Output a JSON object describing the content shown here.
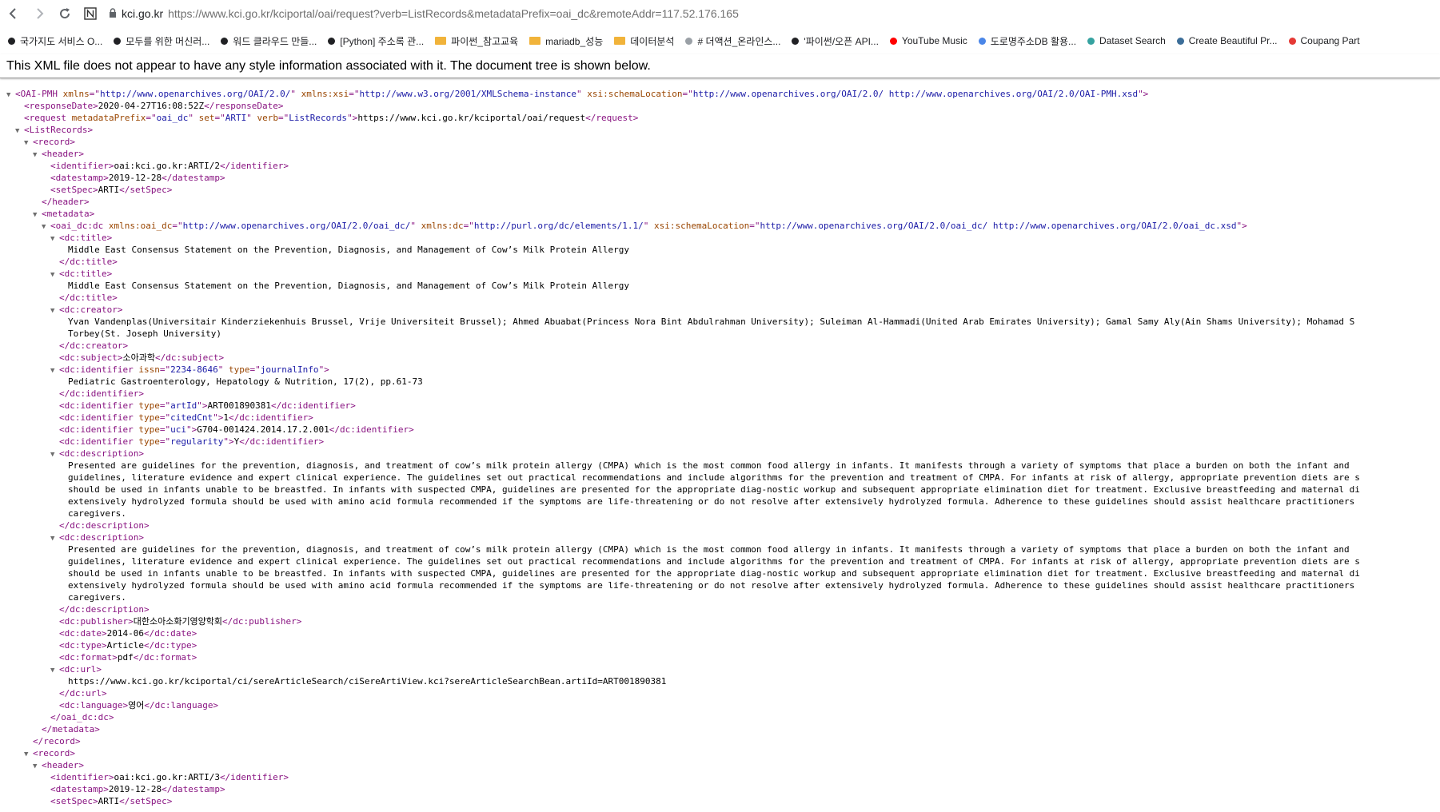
{
  "browser": {
    "domain": "kci.go.kr",
    "url_rest": "https://www.kci.go.kr/kciportal/oai/request?verb=ListRecords&metadataPrefix=oai_dc&remoteAddr=117.52.176.165",
    "icons": [
      "back-arrow-icon",
      "forward-arrow-icon",
      "reload-icon",
      "n-extension-icon",
      "lock-icon"
    ]
  },
  "bookmarks": [
    {
      "label": "국가지도 서비스 O...",
      "icon": "dot",
      "color": "#202124"
    },
    {
      "label": "모두를 위한 머신러...",
      "icon": "dot",
      "color": "#202124"
    },
    {
      "label": "워드 클라우드 만들...",
      "icon": "dot",
      "color": "#202124"
    },
    {
      "label": "[Python] 주소록 관...",
      "icon": "dot",
      "color": "#202124"
    },
    {
      "label": "파이썬_참고교육",
      "icon": "folder",
      "color": "#f1b33a"
    },
    {
      "label": "mariadb_성능",
      "icon": "folder",
      "color": "#f1b33a"
    },
    {
      "label": "데이터분석",
      "icon": "folder",
      "color": "#f1b33a"
    },
    {
      "label": "# 더액션_온라인스...",
      "icon": "dot",
      "color": "#9aa0a6"
    },
    {
      "label": "'파이썬/오픈 API...",
      "icon": "dot",
      "color": "#202124"
    },
    {
      "label": "YouTube Music",
      "icon": "dot",
      "color": "#ff0000"
    },
    {
      "label": "도로명주소DB 활용...",
      "icon": "dot",
      "color": "#4a86e8"
    },
    {
      "label": "Dataset Search",
      "icon": "dot",
      "color": "#35a2a0"
    },
    {
      "label": "Create Beautiful Pr...",
      "icon": "dot",
      "color": "#3c6e99"
    },
    {
      "label": "Coupang Part",
      "icon": "dot",
      "color": "#e53935"
    }
  ],
  "info_text": "This XML file does not appear to have any style information associated with it. The document tree is shown below.",
  "tree": [
    {
      "ind": 0,
      "tog": "▼",
      "s": [
        [
          "t",
          "<OAI-PMH "
        ],
        [
          "an",
          "xmlns"
        ],
        [
          "t",
          "=\""
        ],
        [
          "av",
          "http://www.openarchives.org/OAI/2.0/"
        ],
        [
          "t",
          "\" "
        ],
        [
          "an",
          "xmlns:xsi"
        ],
        [
          "t",
          "=\""
        ],
        [
          "av",
          "http://www.w3.org/2001/XMLSchema-instance"
        ],
        [
          "t",
          "\" "
        ],
        [
          "an",
          "xsi:schemaLocation"
        ],
        [
          "t",
          "=\""
        ],
        [
          "av",
          "http://www.openarchives.org/OAI/2.0/ http://www.openarchives.org/OAI/2.0/OAI-PMH.xsd"
        ],
        [
          "t",
          "\">"
        ]
      ]
    },
    {
      "ind": 1,
      "tog": "",
      "s": [
        [
          "t",
          "<responseDate>"
        ],
        [
          "x",
          "2020-04-27T16:08:52Z"
        ],
        [
          "t",
          "</responseDate>"
        ]
      ]
    },
    {
      "ind": 1,
      "tog": "",
      "s": [
        [
          "t",
          "<request "
        ],
        [
          "an",
          "metadataPrefix"
        ],
        [
          "t",
          "=\""
        ],
        [
          "av",
          "oai_dc"
        ],
        [
          "t",
          "\" "
        ],
        [
          "an",
          "set"
        ],
        [
          "t",
          "=\""
        ],
        [
          "av",
          "ARTI"
        ],
        [
          "t",
          "\" "
        ],
        [
          "an",
          "verb"
        ],
        [
          "t",
          "=\""
        ],
        [
          "av",
          "ListRecords"
        ],
        [
          "t",
          "\">"
        ],
        [
          "x",
          "https://www.kci.go.kr/kciportal/oai/request"
        ],
        [
          "t",
          "</request>"
        ]
      ]
    },
    {
      "ind": 1,
      "tog": "▼",
      "s": [
        [
          "t",
          "<ListRecords>"
        ]
      ]
    },
    {
      "ind": 2,
      "tog": "▼",
      "s": [
        [
          "t",
          "<record>"
        ]
      ]
    },
    {
      "ind": 3,
      "tog": "▼",
      "s": [
        [
          "t",
          "<header>"
        ]
      ]
    },
    {
      "ind": 4,
      "tog": "",
      "s": [
        [
          "t",
          "<identifier>"
        ],
        [
          "x",
          "oai:kci.go.kr:ARTI/2"
        ],
        [
          "t",
          "</identifier>"
        ]
      ]
    },
    {
      "ind": 4,
      "tog": "",
      "s": [
        [
          "t",
          "<datestamp>"
        ],
        [
          "x",
          "2019-12-28"
        ],
        [
          "t",
          "</datestamp>"
        ]
      ]
    },
    {
      "ind": 4,
      "tog": "",
      "s": [
        [
          "t",
          "<setSpec>"
        ],
        [
          "x",
          "ARTI"
        ],
        [
          "t",
          "</setSpec>"
        ]
      ]
    },
    {
      "ind": 3,
      "tog": "",
      "s": [
        [
          "t",
          "</header>"
        ]
      ]
    },
    {
      "ind": 3,
      "tog": "▼",
      "s": [
        [
          "t",
          "<metadata>"
        ]
      ]
    },
    {
      "ind": 4,
      "tog": "▼",
      "s": [
        [
          "t",
          "<oai_dc:dc "
        ],
        [
          "an",
          "xmlns:oai_dc"
        ],
        [
          "t",
          "=\""
        ],
        [
          "av",
          "http://www.openarchives.org/OAI/2.0/oai_dc/"
        ],
        [
          "t",
          "\" "
        ],
        [
          "an",
          "xmlns:dc"
        ],
        [
          "t",
          "=\""
        ],
        [
          "av",
          "http://purl.org/dc/elements/1.1/"
        ],
        [
          "t",
          "\" "
        ],
        [
          "an",
          "xsi:schemaLocation"
        ],
        [
          "t",
          "=\""
        ],
        [
          "av",
          "http://www.openarchives.org/OAI/2.0/oai_dc/ http://www.openarchives.org/OAI/2.0/oai_dc.xsd"
        ],
        [
          "t",
          "\">"
        ]
      ]
    },
    {
      "ind": 5,
      "tog": "▼",
      "s": [
        [
          "t",
          "<dc:title>"
        ]
      ]
    },
    {
      "ind": 6,
      "tog": "",
      "s": [
        [
          "x",
          "Middle East Consensus Statement on the Prevention, Diagnosis, and Management of Cow’s Milk Protein Allergy"
        ]
      ]
    },
    {
      "ind": 5,
      "tog": "",
      "s": [
        [
          "t",
          "</dc:title>"
        ]
      ]
    },
    {
      "ind": 5,
      "tog": "▼",
      "s": [
        [
          "t",
          "<dc:title>"
        ]
      ]
    },
    {
      "ind": 6,
      "tog": "",
      "s": [
        [
          "x",
          "Middle East Consensus Statement on the Prevention, Diagnosis, and Management of Cow’s Milk Protein Allergy"
        ]
      ]
    },
    {
      "ind": 5,
      "tog": "",
      "s": [
        [
          "t",
          "</dc:title>"
        ]
      ]
    },
    {
      "ind": 5,
      "tog": "▼",
      "s": [
        [
          "t",
          "<dc:creator>"
        ]
      ]
    },
    {
      "ind": 6,
      "tog": "",
      "s": [
        [
          "x",
          "Yvan Vandenplas(Universitair Kinderziekenhuis Brussel, Vrije Universiteit Brussel); Ahmed Abuabat(Princess Nora Bint Abdulrahman University); Suleiman Al-Hammadi(United Arab Emirates University); Gamal Samy Aly(Ain Shams University); Mohamad S"
        ]
      ]
    },
    {
      "ind": 6,
      "tog": "",
      "s": [
        [
          "x",
          "Torbey(St. Joseph University)"
        ]
      ]
    },
    {
      "ind": 5,
      "tog": "",
      "s": [
        [
          "t",
          "</dc:creator>"
        ]
      ]
    },
    {
      "ind": 5,
      "tog": "",
      "s": [
        [
          "t",
          "<dc:subject>"
        ],
        [
          "x",
          "소아과학"
        ],
        [
          "t",
          "</dc:subject>"
        ]
      ]
    },
    {
      "ind": 5,
      "tog": "▼",
      "s": [
        [
          "t",
          "<dc:identifier "
        ],
        [
          "an",
          "issn"
        ],
        [
          "t",
          "=\""
        ],
        [
          "av",
          "2234-8646"
        ],
        [
          "t",
          "\" "
        ],
        [
          "an",
          "type"
        ],
        [
          "t",
          "=\""
        ],
        [
          "av",
          "journalInfo"
        ],
        [
          "t",
          "\">"
        ]
      ]
    },
    {
      "ind": 6,
      "tog": "",
      "s": [
        [
          "x",
          "Pediatric Gastroenterology, Hepatology & Nutrition, 17(2), pp.61-73"
        ]
      ]
    },
    {
      "ind": 5,
      "tog": "",
      "s": [
        [
          "t",
          "</dc:identifier>"
        ]
      ]
    },
    {
      "ind": 5,
      "tog": "",
      "s": [
        [
          "t",
          "<dc:identifier "
        ],
        [
          "an",
          "type"
        ],
        [
          "t",
          "=\""
        ],
        [
          "av",
          "artId"
        ],
        [
          "t",
          "\">"
        ],
        [
          "x",
          "ART001890381"
        ],
        [
          "t",
          "</dc:identifier>"
        ]
      ]
    },
    {
      "ind": 5,
      "tog": "",
      "s": [
        [
          "t",
          "<dc:identifier "
        ],
        [
          "an",
          "type"
        ],
        [
          "t",
          "=\""
        ],
        [
          "av",
          "citedCnt"
        ],
        [
          "t",
          "\">"
        ],
        [
          "x",
          "1"
        ],
        [
          "t",
          "</dc:identifier>"
        ]
      ]
    },
    {
      "ind": 5,
      "tog": "",
      "s": [
        [
          "t",
          "<dc:identifier "
        ],
        [
          "an",
          "type"
        ],
        [
          "t",
          "=\""
        ],
        [
          "av",
          "uci"
        ],
        [
          "t",
          "\">"
        ],
        [
          "x",
          "G704-001424.2014.17.2.001"
        ],
        [
          "t",
          "</dc:identifier>"
        ]
      ]
    },
    {
      "ind": 5,
      "tog": "",
      "s": [
        [
          "t",
          "<dc:identifier "
        ],
        [
          "an",
          "type"
        ],
        [
          "t",
          "=\""
        ],
        [
          "av",
          "regularity"
        ],
        [
          "t",
          "\">"
        ],
        [
          "x",
          "Y"
        ],
        [
          "t",
          "</dc:identifier>"
        ]
      ]
    },
    {
      "ind": 5,
      "tog": "▼",
      "s": [
        [
          "t",
          "<dc:description>"
        ]
      ]
    },
    {
      "ind": 6,
      "tog": "",
      "s": [
        [
          "x",
          "Presented are guidelines for the prevention, diagnosis, and treatment of cow’s milk protein allergy (CMPA) which is the most common food allergy in infants. It manifests through a variety of symptoms that place a burden on both the infant and"
        ]
      ]
    },
    {
      "ind": 6,
      "tog": "",
      "s": [
        [
          "x",
          "guidelines, literature evidence and expert clinical experience. The guidelines set out practical recommendations and include algorithms for the prevention and treatment of CMPA. For infants at risk of allergy, appropriate prevention diets are s"
        ]
      ]
    },
    {
      "ind": 6,
      "tog": "",
      "s": [
        [
          "x",
          "should be used in infants unable to be breastfed. In infants with suspected CMPA, guidelines are presented for the appropriate diag-nostic workup and subsequent appropriate elimination diet for treatment. Exclusive breastfeeding and maternal di"
        ]
      ]
    },
    {
      "ind": 6,
      "tog": "",
      "s": [
        [
          "x",
          "extensively hydrolyzed formula should be used with amino acid formula recommended if the symptoms are life-threatening or do not resolve after extensively hydrolyzed formula. Adherence to these guidelines should assist healthcare practitioners"
        ]
      ]
    },
    {
      "ind": 6,
      "tog": "",
      "s": [
        [
          "x",
          "caregivers."
        ]
      ]
    },
    {
      "ind": 5,
      "tog": "",
      "s": [
        [
          "t",
          "</dc:description>"
        ]
      ]
    },
    {
      "ind": 5,
      "tog": "▼",
      "s": [
        [
          "t",
          "<dc:description>"
        ]
      ]
    },
    {
      "ind": 6,
      "tog": "",
      "s": [
        [
          "x",
          "Presented are guidelines for the prevention, diagnosis, and treatment of cow’s milk protein allergy (CMPA) which is the most common food allergy in infants. It manifests through a variety of symptoms that place a burden on both the infant and"
        ]
      ]
    },
    {
      "ind": 6,
      "tog": "",
      "s": [
        [
          "x",
          "guidelines, literature evidence and expert clinical experience. The guidelines set out practical recommendations and include algorithms for the prevention and treatment of CMPA. For infants at risk of allergy, appropriate prevention diets are s"
        ]
      ]
    },
    {
      "ind": 6,
      "tog": "",
      "s": [
        [
          "x",
          "should be used in infants unable to be breastfed. In infants with suspected CMPA, guidelines are presented for the appropriate diag-nostic workup and subsequent appropriate elimination diet for treatment. Exclusive breastfeeding and maternal di"
        ]
      ]
    },
    {
      "ind": 6,
      "tog": "",
      "s": [
        [
          "x",
          "extensively hydrolyzed formula should be used with amino acid formula recommended if the symptoms are life-threatening or do not resolve after extensively hydrolyzed formula. Adherence to these guidelines should assist healthcare practitioners"
        ]
      ]
    },
    {
      "ind": 6,
      "tog": "",
      "s": [
        [
          "x",
          "caregivers."
        ]
      ]
    },
    {
      "ind": 5,
      "tog": "",
      "s": [
        [
          "t",
          "</dc:description>"
        ]
      ]
    },
    {
      "ind": 5,
      "tog": "",
      "s": [
        [
          "t",
          "<dc:publisher>"
        ],
        [
          "x",
          "대한소아소화기영양학회"
        ],
        [
          "t",
          "</dc:publisher>"
        ]
      ]
    },
    {
      "ind": 5,
      "tog": "",
      "s": [
        [
          "t",
          "<dc:date>"
        ],
        [
          "x",
          "2014-06"
        ],
        [
          "t",
          "</dc:date>"
        ]
      ]
    },
    {
      "ind": 5,
      "tog": "",
      "s": [
        [
          "t",
          "<dc:type>"
        ],
        [
          "x",
          "Article"
        ],
        [
          "t",
          "</dc:type>"
        ]
      ]
    },
    {
      "ind": 5,
      "tog": "",
      "s": [
        [
          "t",
          "<dc:format>"
        ],
        [
          "x",
          "pdf"
        ],
        [
          "t",
          "</dc:format>"
        ]
      ]
    },
    {
      "ind": 5,
      "tog": "▼",
      "s": [
        [
          "t",
          "<dc:url>"
        ]
      ]
    },
    {
      "ind": 6,
      "tog": "",
      "s": [
        [
          "x",
          "https://www.kci.go.kr/kciportal/ci/sereArticleSearch/ciSereArtiView.kci?sereArticleSearchBean.artiId=ART001890381"
        ]
      ]
    },
    {
      "ind": 5,
      "tog": "",
      "s": [
        [
          "t",
          "</dc:url>"
        ]
      ]
    },
    {
      "ind": 5,
      "tog": "",
      "s": [
        [
          "t",
          "<dc:language>"
        ],
        [
          "x",
          "영어"
        ],
        [
          "t",
          "</dc:language>"
        ]
      ]
    },
    {
      "ind": 4,
      "tog": "",
      "s": [
        [
          "t",
          "</oai_dc:dc>"
        ]
      ]
    },
    {
      "ind": 3,
      "tog": "",
      "s": [
        [
          "t",
          "</metadata>"
        ]
      ]
    },
    {
      "ind": 2,
      "tog": "",
      "s": [
        [
          "t",
          "</record>"
        ]
      ]
    },
    {
      "ind": 2,
      "tog": "▼",
      "s": [
        [
          "t",
          "<record>"
        ]
      ]
    },
    {
      "ind": 3,
      "tog": "▼",
      "s": [
        [
          "t",
          "<header>"
        ]
      ]
    },
    {
      "ind": 4,
      "tog": "",
      "s": [
        [
          "t",
          "<identifier>"
        ],
        [
          "x",
          "oai:kci.go.kr:ARTI/3"
        ],
        [
          "t",
          "</identifier>"
        ]
      ]
    },
    {
      "ind": 4,
      "tog": "",
      "s": [
        [
          "t",
          "<datestamp>"
        ],
        [
          "x",
          "2019-12-28"
        ],
        [
          "t",
          "</datestamp>"
        ]
      ]
    },
    {
      "ind": 4,
      "tog": "",
      "s": [
        [
          "t",
          "<setSpec>"
        ],
        [
          "x",
          "ARTI"
        ],
        [
          "t",
          "</setSpec>"
        ]
      ]
    }
  ]
}
